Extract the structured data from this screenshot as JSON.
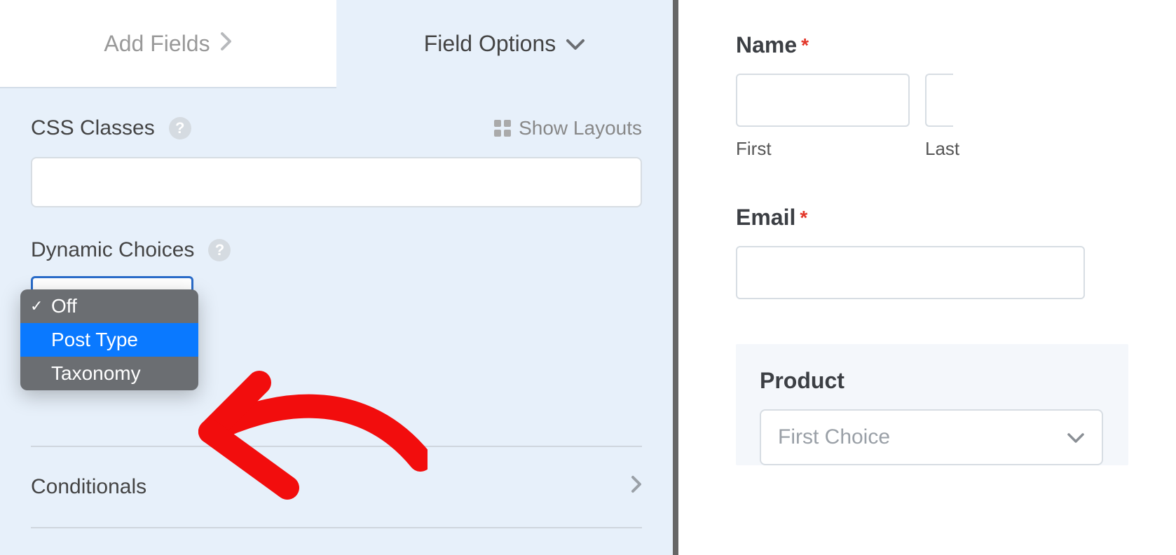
{
  "tabs": {
    "add_fields": "Add Fields",
    "field_options": "Field Options"
  },
  "left": {
    "css_classes_label": "CSS Classes",
    "show_layouts": "Show Layouts",
    "css_classes_value": "",
    "dynamic_choices_label": "Dynamic Choices",
    "dropdown": {
      "off": "Off",
      "post_type": "Post Type",
      "taxonomy": "Taxonomy"
    },
    "conditionals": "Conditionals"
  },
  "preview": {
    "name_label": "Name",
    "first": "First",
    "last": "Last",
    "email_label": "Email",
    "product_label": "Product",
    "product_placeholder": "First Choice"
  }
}
